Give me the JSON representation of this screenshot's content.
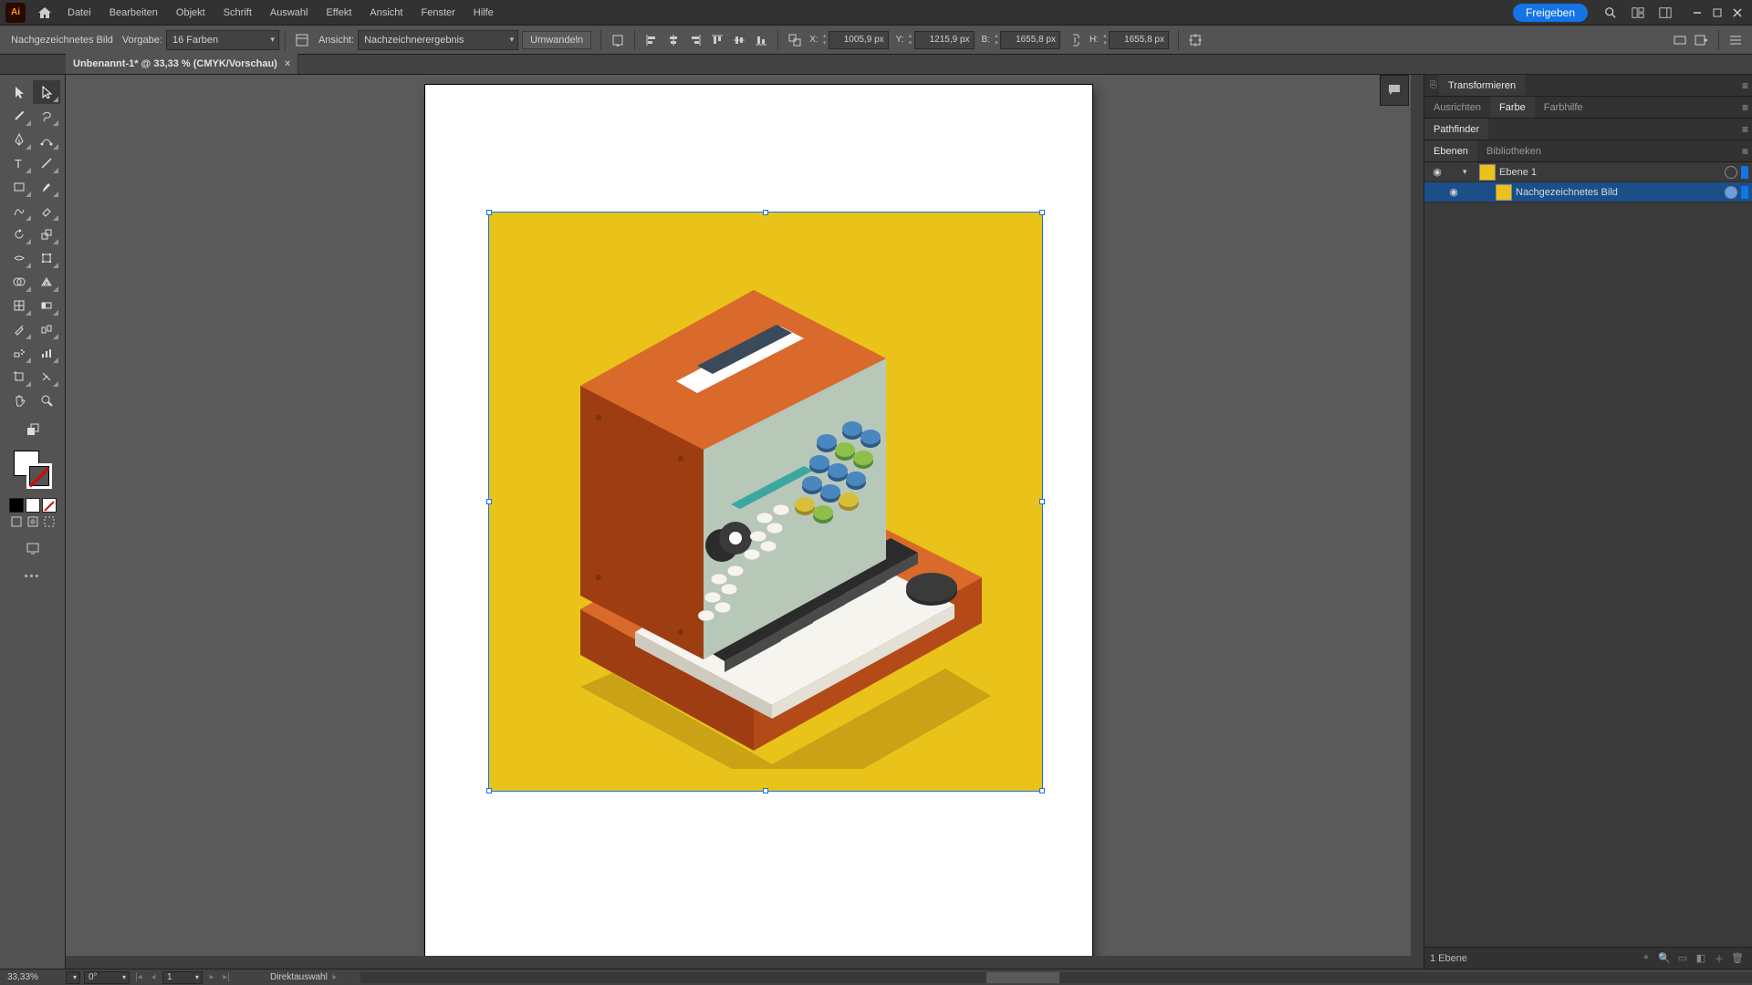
{
  "menu": {
    "items": [
      "Datei",
      "Bearbeiten",
      "Objekt",
      "Schrift",
      "Auswahl",
      "Effekt",
      "Ansicht",
      "Fenster",
      "Hilfe"
    ],
    "share": "Freigeben"
  },
  "control": {
    "object_type": "Nachgezeichnetes Bild",
    "preset_label": "Vorgabe:",
    "preset_value": "16 Farben",
    "view_label": "Ansicht:",
    "view_value": "Nachzeichnerergebnis",
    "expand_btn": "Umwandeln",
    "x_label": "X:",
    "x_value": "1005,9 px",
    "y_label": "Y:",
    "y_value": "1215,9 px",
    "w_label": "B:",
    "w_value": "1655,8 px",
    "h_label": "H:",
    "h_value": "1655,8 px"
  },
  "tab": {
    "title": "Unbenannt-1* @ 33,33 % (CMYK/Vorschau)",
    "close": "×"
  },
  "panels": {
    "transform": "Transformieren",
    "align": "Ausrichten",
    "color": "Farbe",
    "guide": "Farbhilfe",
    "pathfinder": "Pathfinder",
    "layers": "Ebenen",
    "libraries": "Bibliotheken"
  },
  "layers": {
    "row1": "Ebene 1",
    "row2": "Nachgezeichnetes Bild",
    "footer_count": "1 Ebene"
  },
  "status": {
    "zoom": "33,33%",
    "rotate": "0°",
    "artboard_num": "1",
    "tool": "Direktauswahl"
  }
}
